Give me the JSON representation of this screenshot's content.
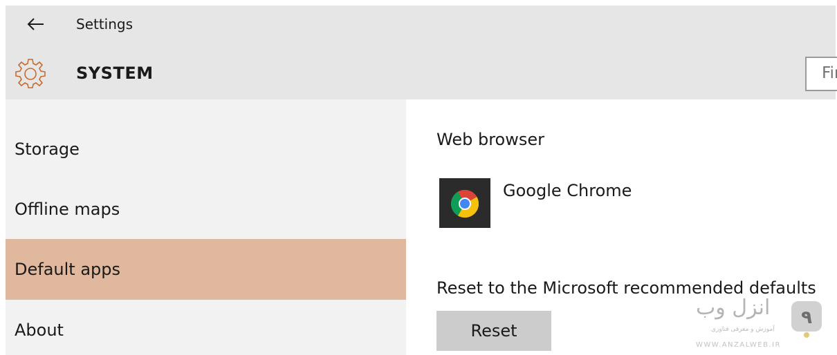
{
  "window": {
    "title": "Settings",
    "back_icon": "back-arrow-icon"
  },
  "header": {
    "icon": "gear-icon",
    "section_title": "SYSTEM",
    "search_placeholder": "Fir"
  },
  "sidebar": {
    "items": [
      {
        "label": "Storage",
        "selected": false
      },
      {
        "label": "Offline maps",
        "selected": false
      },
      {
        "label": "Default apps",
        "selected": true
      },
      {
        "label": "About",
        "selected": false
      }
    ]
  },
  "main": {
    "web_browser": {
      "heading": "Web browser",
      "app_name": "Google Chrome",
      "app_icon": "chrome-icon"
    },
    "reset": {
      "description": "Reset to the Microsoft recommended defaults",
      "button_label": "Reset"
    }
  },
  "watermark": {
    "brand": "انزل وب",
    "tagline": "آموزش و معرفی فناوری",
    "url": "WWW.ANZALWEB.IR"
  },
  "colors": {
    "header_bg": "#e6e6e6",
    "sidebar_bg": "#f2f2f2",
    "selected_item_bg": "#e0b89d",
    "accent_orange": "#c86a2a",
    "button_bg": "#cccccc"
  }
}
